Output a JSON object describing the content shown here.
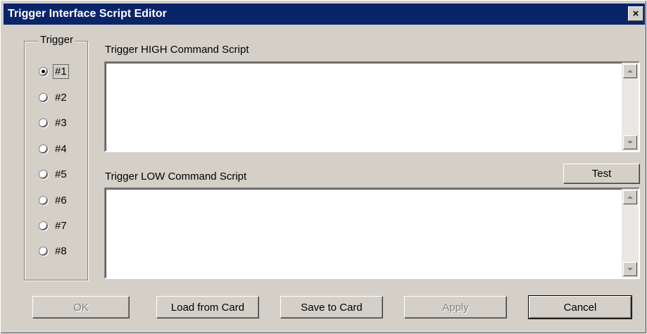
{
  "window": {
    "title": "Trigger Interface Script Editor",
    "close_symbol": "×"
  },
  "trigger_group": {
    "label": "Trigger",
    "options": [
      {
        "label": "#1",
        "checked": true
      },
      {
        "label": "#2",
        "checked": false
      },
      {
        "label": "#3",
        "checked": false
      },
      {
        "label": "#4",
        "checked": false
      },
      {
        "label": "#5",
        "checked": false
      },
      {
        "label": "#6",
        "checked": false
      },
      {
        "label": "#7",
        "checked": false
      },
      {
        "label": "#8",
        "checked": false
      }
    ]
  },
  "high_script": {
    "label": "Trigger HIGH Command Script",
    "value": ""
  },
  "low_script": {
    "label": "Trigger LOW Command Script",
    "value": ""
  },
  "buttons": {
    "test": "Test",
    "ok": "OK",
    "load": "Load from Card",
    "save": "Save to Card",
    "apply": "Apply",
    "cancel": "Cancel"
  }
}
